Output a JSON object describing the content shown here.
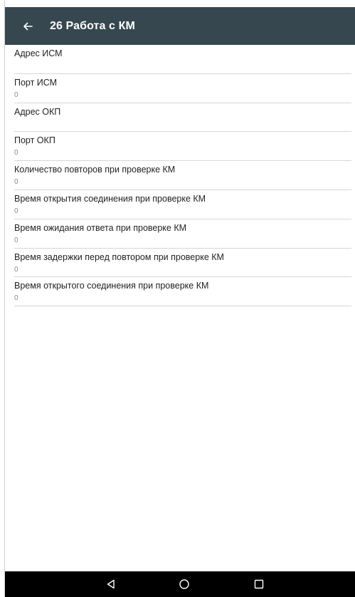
{
  "appbar": {
    "title": "26 Работа с КМ",
    "back_icon": "arrow-left-icon",
    "background": "#36474f"
  },
  "settings": [
    {
      "label": "Адрес ИСМ",
      "value": ""
    },
    {
      "label": "Порт ИСМ",
      "value": "0"
    },
    {
      "label": "Адрес ОКП",
      "value": ""
    },
    {
      "label": "Порт ОКП",
      "value": "0"
    },
    {
      "label": "Количество повторов при проверке КМ",
      "value": "0"
    },
    {
      "label": "Время открытия соединения при проверке КМ",
      "value": "0"
    },
    {
      "label": "Время ожидания ответа при проверке КМ",
      "value": "0"
    },
    {
      "label": "Время задержки перед повтором при проверке КМ",
      "value": "0"
    },
    {
      "label": "Время открытого соединения при проверке КМ",
      "value": "0"
    }
  ],
  "navbar": {
    "icons": [
      "back-triangle-icon",
      "home-circle-icon",
      "recents-square-icon"
    ]
  }
}
